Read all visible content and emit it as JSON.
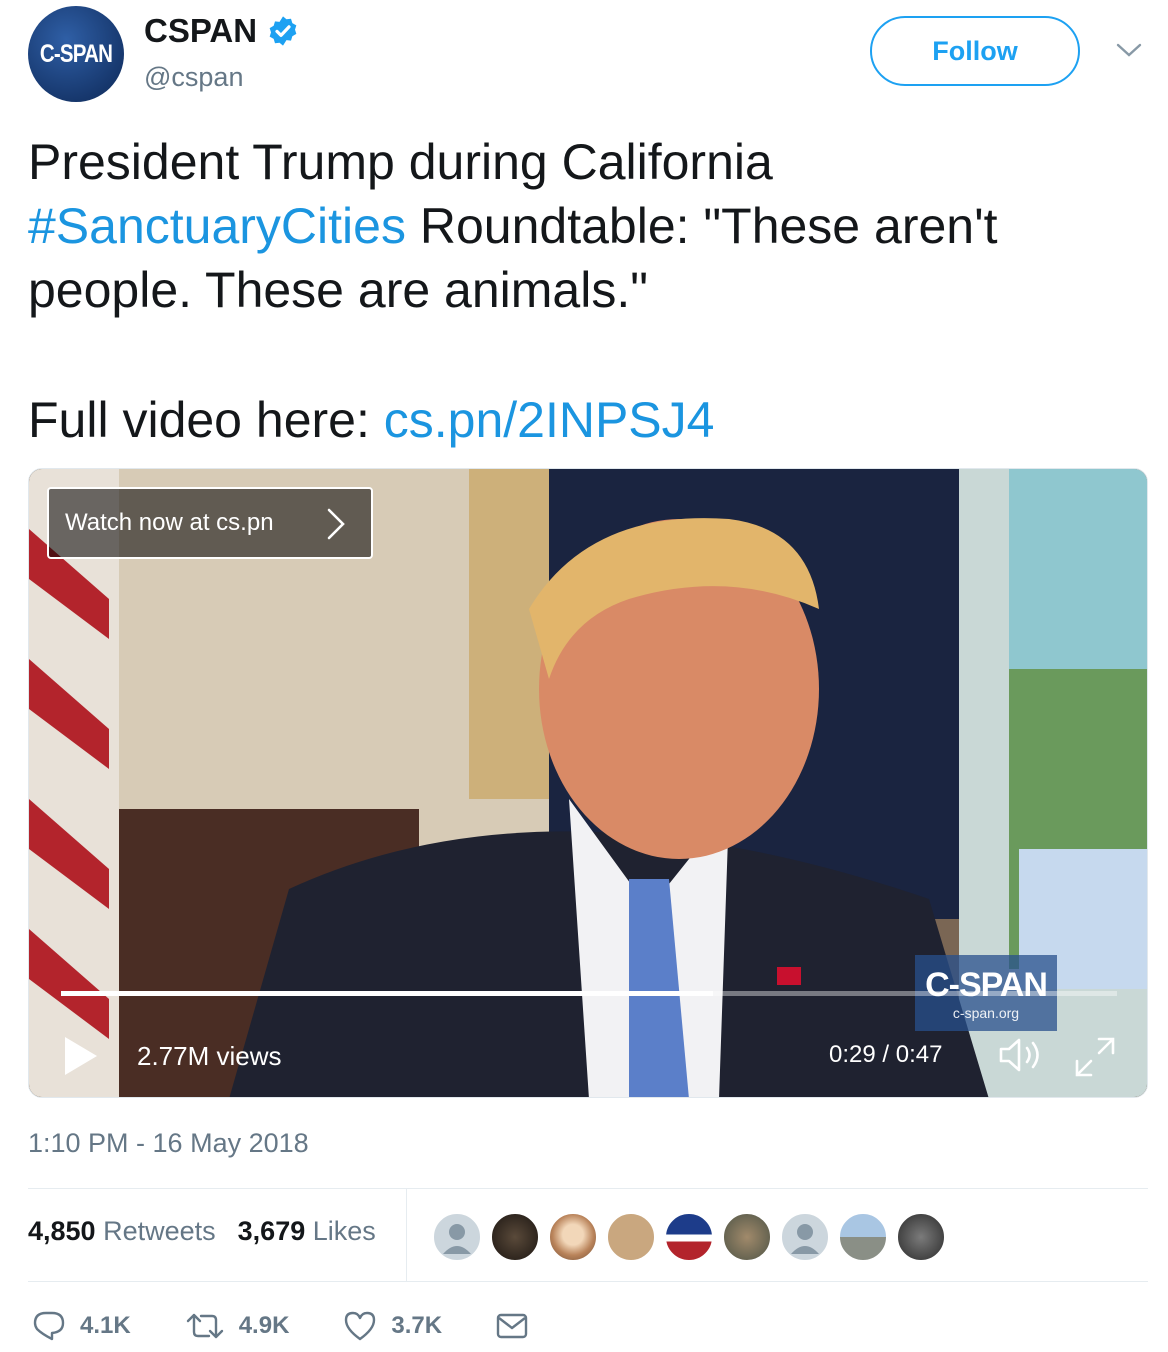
{
  "account": {
    "avatar_text": "C-SPAN",
    "display_name": "CSPAN",
    "handle": "@cspan",
    "verified": true,
    "follow_label": "Follow"
  },
  "tweet": {
    "text_part1": "President Trump during California ",
    "hashtag": "#SanctuaryCities",
    "text_part2": " Roundtable: \"These aren't people. These are animals.\"",
    "full_video_label": "Full video here: ",
    "link": "cs.pn/2INPSJ4"
  },
  "video": {
    "watch_label": "Watch now at cs.pn",
    "views": "2.77M views",
    "time": "0:29 / 0:47",
    "progress": 0.617,
    "bug_title": "C-SPAN",
    "bug_url": "c-span.org"
  },
  "meta": {
    "timestamp": "1:10 PM - 16 May 2018",
    "retweets_count": "4,850",
    "retweets_label": "Retweets",
    "likes_count": "3,679",
    "likes_label": "Likes"
  },
  "actions": {
    "replies": "4.1K",
    "retweets": "4.9K",
    "likes": "3.7K"
  },
  "colors": {
    "accent": "#1da1f2",
    "link": "#1b95e0",
    "muted": "#657786"
  }
}
